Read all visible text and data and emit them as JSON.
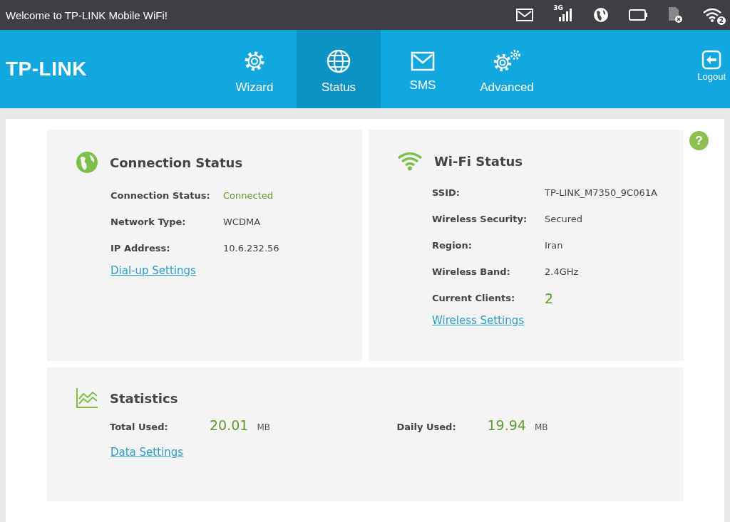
{
  "top_bar": {
    "title": "Welcome to TP-LINK Mobile WiFi!",
    "network_type": "3G",
    "wifi_clients": "2"
  },
  "brand": "TP-LINK",
  "tabs": [
    {
      "label": "Wizard",
      "kind": "gear",
      "selected": false
    },
    {
      "label": "Status",
      "kind": "globe",
      "selected": true
    },
    {
      "label": "SMS",
      "kind": "mail",
      "selected": false
    },
    {
      "label": "Advanced",
      "kind": "gears",
      "selected": false
    }
  ],
  "logout": "Logout",
  "help": "?",
  "connection": {
    "title": "Connection Status",
    "rows": [
      {
        "label": "Connection Status:",
        "value": "Connected",
        "kind": "status"
      },
      {
        "label": "Network Type:",
        "value": "WCDMA",
        "kind": "plain"
      },
      {
        "label": "IP Address:",
        "value": "10.6.232.56",
        "kind": "plain"
      }
    ],
    "link": "Dial-up Settings"
  },
  "wifi": {
    "title": "Wi-Fi Status",
    "rows": [
      {
        "label": "SSID:",
        "value": "TP-LINK_M7350_9C061A",
        "kind": "plain"
      },
      {
        "label": "Wireless Security:",
        "value": "Secured",
        "kind": "plain"
      },
      {
        "label": "Region:",
        "value": "Iran",
        "kind": "plain"
      },
      {
        "label": "Wireless Band:",
        "value": "2.4GHz",
        "kind": "plain"
      },
      {
        "label": "Current Clients:",
        "value": "2",
        "kind": "count"
      }
    ],
    "link": "Wireless Settings"
  },
  "statistics": {
    "title": "Statistics",
    "items": [
      {
        "label": "Total Used:",
        "value": "20.01",
        "unit": "MB"
      },
      {
        "label": "Daily Used:",
        "value": "19.94",
        "unit": "MB"
      }
    ],
    "link": "Data Settings"
  }
}
